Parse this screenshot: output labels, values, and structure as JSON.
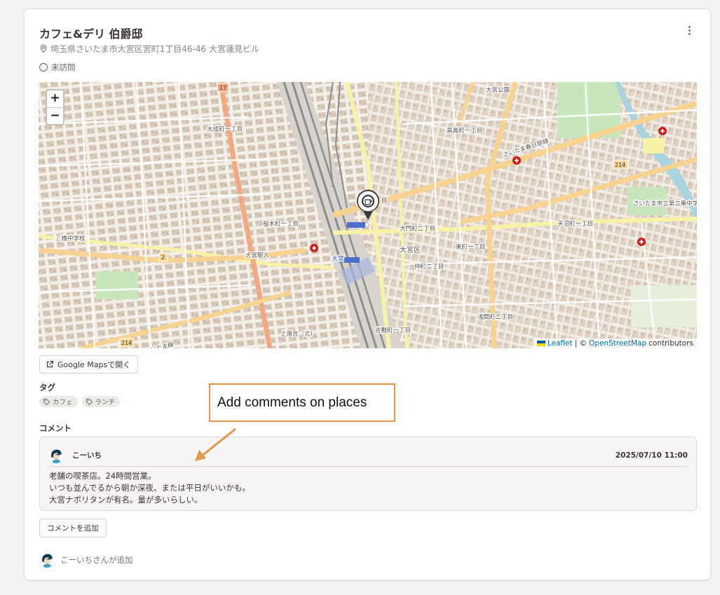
{
  "place": {
    "name": "カフェ&デリ 伯爵邸",
    "address": "埼玉県さいたま市大宮区宮町1丁目46-46 大宮蓮見ビル",
    "visit_status": "未訪問",
    "icons": {
      "more": "more-vertical-icon",
      "address": "map-pin-icon",
      "status": "circle-outline-icon"
    }
  },
  "map": {
    "zoom_in": "+",
    "zoom_out": "−",
    "attribution": {
      "leaflet": "Leaflet",
      "separator": "| ©",
      "osm": "OpenStreetMap",
      "suffix": "contributors"
    },
    "labels": {
      "l1": "大宮公園",
      "l2": "大宮区",
      "l3": "大宮駅入",
      "l4": "さいたま市立第二東中学校",
      "l5": "大宮",
      "l6": "214",
      "l7": "17",
      "l8": "2",
      "l9": "大成町一丁目",
      "l10": "桜木町一丁目",
      "l11": "東町一丁目",
      "l12": "天沼町一丁目",
      "l13": "高鼻町一丁目",
      "l14": "宮町二丁目",
      "l15": "大門町二丁目",
      "l16": "さいたま春日部線",
      "l17": "新方須賀さいたま線",
      "l18": "三橋中学校",
      "l19": "吉敷町一丁目",
      "l20": "上落合（北）",
      "l21": "仲町二丁目",
      "l22": "浅間町二丁目"
    },
    "colors": {
      "major_road": "#f1a883",
      "secondary_road": "#f7d290",
      "yellow_road": "#f8f2a8",
      "rail": "#8c8c8c",
      "park": "#c8e6bb",
      "water": "#a9d3df",
      "block": "#e3d8cb",
      "building": "#d5c6b4",
      "poi": "#d11c1c"
    }
  },
  "actions": {
    "google_maps": "Google Mapsで開く",
    "google_maps_icon": "external-link-icon",
    "add_comment": "コメントを追加"
  },
  "tags": {
    "label": "タグ",
    "items": [
      {
        "name": "カフェ",
        "icon": "tag-icon"
      },
      {
        "name": "ランチ",
        "icon": "tag-icon"
      }
    ]
  },
  "comments": {
    "label": "コメント",
    "items": [
      {
        "author": "こーいち",
        "date": "2025/07/10 11:00",
        "lines": [
          "老舗の喫茶店。24時間営業。",
          "いつも並んでるから朝か深夜、または平日がいいかも。",
          "大宮ナポリタンが有名。量が多いらしい。"
        ]
      }
    ]
  },
  "footer": {
    "added_by": "こーいちさんが追加"
  },
  "annotation": {
    "text": "Add comments on places",
    "color": "#e0974a"
  }
}
